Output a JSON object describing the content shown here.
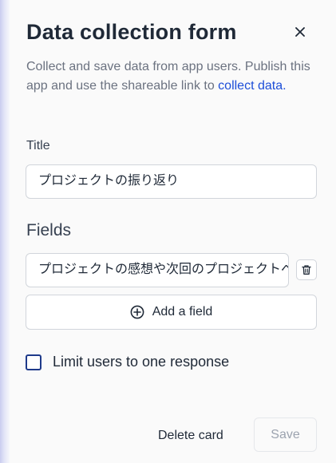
{
  "panel": {
    "title": "Data collection form",
    "description": "Collect and save data from app users. Publish this app and use the shareable link to ",
    "description_link": "collect data."
  },
  "title_field": {
    "label": "Title",
    "value": "プロジェクトの振り返り"
  },
  "fields": {
    "heading": "Fields",
    "items": [
      {
        "value": "プロジェクトの感想や次回のプロジェクトへの改善点"
      }
    ],
    "add_label": "Add a field"
  },
  "options": {
    "limit_label": "Limit users to one response",
    "limit_checked": false
  },
  "footer": {
    "delete_label": "Delete card",
    "save_label": "Save"
  },
  "colors": {
    "link": "#1d4ed8",
    "checkbox_border": "#1e3a8a",
    "disabled_text": "#9ca3af"
  },
  "icons": [
    "close-icon",
    "trash-icon",
    "plus-circle-icon"
  ]
}
